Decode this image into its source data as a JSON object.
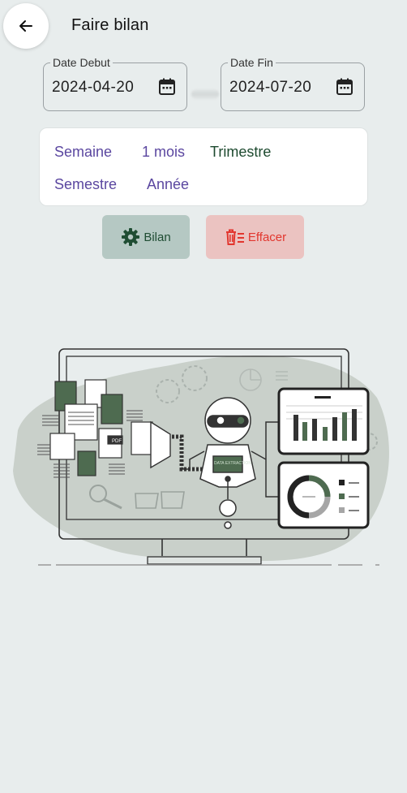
{
  "header": {
    "title": "Faire bilan"
  },
  "date_start": {
    "label": "Date Debut",
    "value": "2024-04-20"
  },
  "date_end": {
    "label": "Date Fin",
    "value": "2024-07-20"
  },
  "periods": {
    "semaine": "Semaine",
    "mois": "1 mois",
    "trimestre": "Trimestre",
    "semestre": "Semestre",
    "annee": "Année",
    "selected": "Trimestre"
  },
  "actions": {
    "bilan": "Bilan",
    "effacer": "Effacer"
  },
  "illustration": {
    "robot_label": "DATA EXTRACTION",
    "doc_label": "PDF"
  },
  "colors": {
    "accent_green": "#1f4d33",
    "danger": "#e2362e",
    "period_text": "#5b47a0",
    "background": "#e8eded"
  }
}
